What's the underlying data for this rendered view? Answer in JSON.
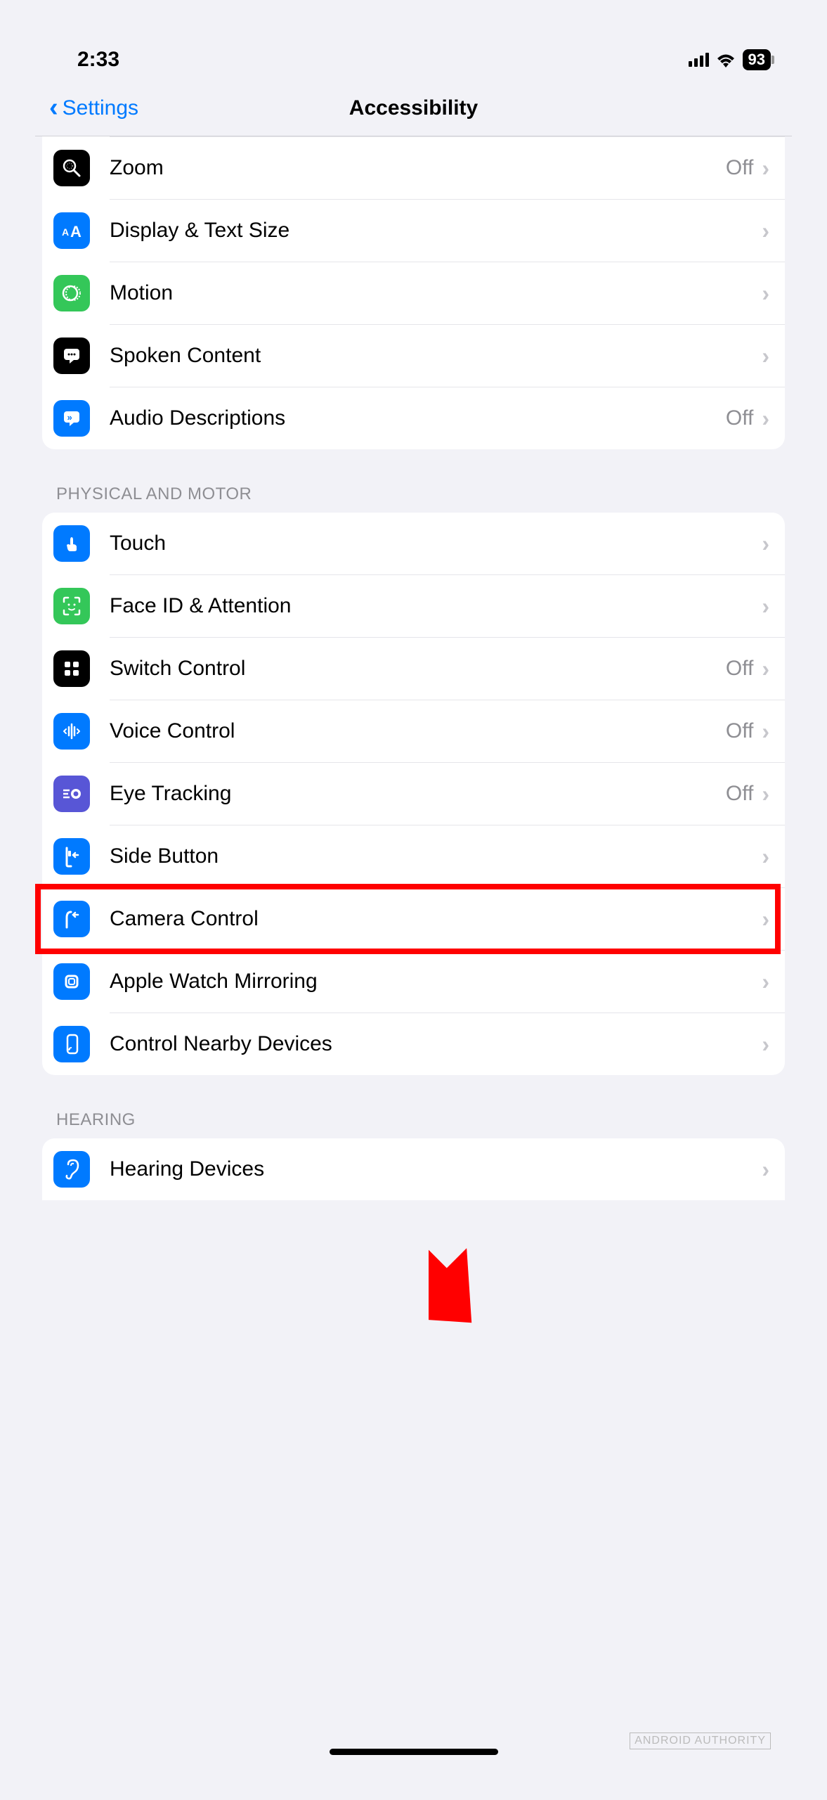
{
  "status": {
    "time": "2:33",
    "battery": "93"
  },
  "nav": {
    "back_label": "Settings",
    "title": "Accessibility"
  },
  "sections": [
    {
      "header": null,
      "items": [
        {
          "label": "Zoom",
          "value": "Off",
          "icon": "zoom",
          "icon_bg": "black"
        },
        {
          "label": "Display & Text Size",
          "value": null,
          "icon": "text-size",
          "icon_bg": "blue"
        },
        {
          "label": "Motion",
          "value": null,
          "icon": "motion",
          "icon_bg": "green"
        },
        {
          "label": "Spoken Content",
          "value": null,
          "icon": "spoken",
          "icon_bg": "black"
        },
        {
          "label": "Audio Descriptions",
          "value": "Off",
          "icon": "audio-desc",
          "icon_bg": "blue"
        }
      ]
    },
    {
      "header": "PHYSICAL AND MOTOR",
      "items": [
        {
          "label": "Touch",
          "value": null,
          "icon": "touch",
          "icon_bg": "blue"
        },
        {
          "label": "Face ID & Attention",
          "value": null,
          "icon": "faceid",
          "icon_bg": "green"
        },
        {
          "label": "Switch Control",
          "value": "Off",
          "icon": "switch",
          "icon_bg": "black"
        },
        {
          "label": "Voice Control",
          "value": "Off",
          "icon": "voice",
          "icon_bg": "blue"
        },
        {
          "label": "Eye Tracking",
          "value": "Off",
          "icon": "eye",
          "icon_bg": "purple"
        },
        {
          "label": "Side Button",
          "value": null,
          "icon": "side-btn",
          "icon_bg": "blue"
        },
        {
          "label": "Camera Control",
          "value": null,
          "icon": "camera-ctrl",
          "icon_bg": "blue"
        },
        {
          "label": "Apple Watch Mirroring",
          "value": null,
          "icon": "watch",
          "icon_bg": "blue"
        },
        {
          "label": "Control Nearby Devices",
          "value": null,
          "icon": "nearby",
          "icon_bg": "blue"
        }
      ]
    },
    {
      "header": "HEARING",
      "items": [
        {
          "label": "Hearing Devices",
          "value": null,
          "icon": "hearing",
          "icon_bg": "blue"
        }
      ]
    }
  ],
  "annotation": {
    "highlighted_item": "Camera Control"
  },
  "watermark": "ANDROID AUTHORITY"
}
